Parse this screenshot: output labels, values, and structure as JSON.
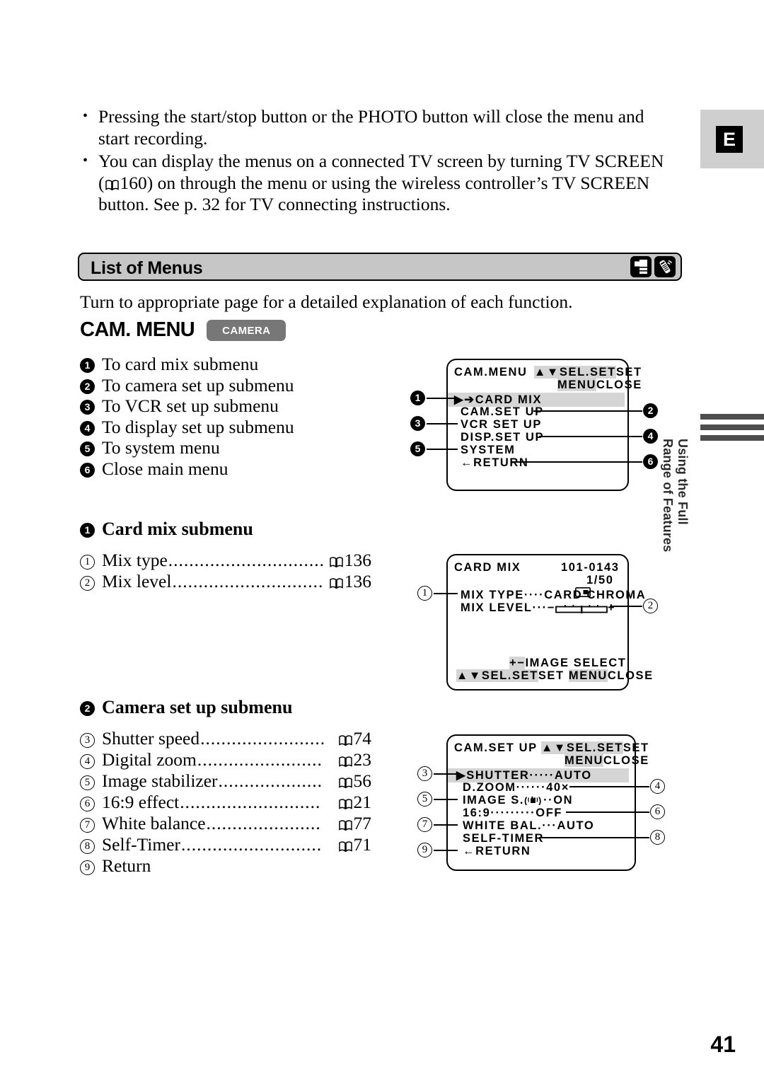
{
  "page": {
    "number": "41",
    "language_tab": "E",
    "side_note": [
      "Using the Full",
      "Range of Features"
    ]
  },
  "intro_bullets": [
    "Pressing the start/stop button or the PHOTO button will close the menu and start recording.",
    "You can display the menus on a connected TV screen by turning TV SCREEN ( 160) on through the menu or using the wireless controller’s TV SCREEN button. See p. 32 for TV connecting instructions."
  ],
  "intro_bullet_1_line1": "Pressing the start/stop button or the PHOTO button will close the menu and",
  "intro_bullet_1_line2": "start recording.",
  "intro_bullet_2_line1": "You can display the menus on a connected TV screen by turning TV SCREEN",
  "intro_bullet_2_line2_pre": "(",
  "intro_bullet_2_line2_post": "160) on through the menu or using the wireless controller’s TV SCREEN",
  "intro_bullet_2_line3": "button. See p. 32 for TV connecting instructions.",
  "section": {
    "title": "List of Menus",
    "icons": [
      "camcorder-icon",
      "wireless-controller-icon"
    ],
    "lead": "Turn to appropriate page for a detailed explanation of each function.",
    "heading": "CAM. MENU",
    "badge": "CAMERA"
  },
  "main_menu_list": [
    {
      "num": "1",
      "label": "To card mix submenu"
    },
    {
      "num": "2",
      "label": "To camera set up submenu"
    },
    {
      "num": "3",
      "label": "To VCR set up submenu"
    },
    {
      "num": "4",
      "label": "To display set up submenu"
    },
    {
      "num": "5",
      "label": "To system menu"
    },
    {
      "num": "6",
      "label": "Close main menu"
    }
  ],
  "card_mix_section": {
    "num": "1",
    "title": "Card mix submenu",
    "items": [
      {
        "num": "1",
        "label": "Mix type",
        "dots": "..............................",
        "page": "136"
      },
      {
        "num": "2",
        "label": "Mix level",
        "dots": ".............................",
        "page": "136"
      }
    ]
  },
  "camera_setup_section": {
    "num": "2",
    "title": "Camera set up submenu",
    "items": [
      {
        "num": "3",
        "label": "Shutter speed",
        "dots": "........................",
        "page": "74"
      },
      {
        "num": "4",
        "label": "Digital zoom",
        "dots": "........................",
        "page": "23"
      },
      {
        "num": "5",
        "label": "Image stabilizer",
        "dots": "....................",
        "page": "56"
      },
      {
        "num": "6",
        "label": "16:9 effect",
        "dots": "...........................",
        "page": "21"
      },
      {
        "num": "7",
        "label": "White balance",
        "dots": "......................",
        "page": "77"
      },
      {
        "num": "8",
        "label": "Self-Timer",
        "dots": "...........................",
        "page": "71"
      },
      {
        "num": "9",
        "label": "Return",
        "dots": "",
        "page": ""
      }
    ]
  },
  "lcd_cam_menu": {
    "title": "CAM.MENU",
    "hint_line1_hl1": "▲▼SEL.",
    "hint_line1_hl2": "SET",
    "hint_line1_tail": "SET",
    "hint_line2_hl": "MENU",
    "hint_line2_tail": "CLOSE",
    "rows": [
      {
        "callout": "1",
        "text": "▶➔CARD MIX",
        "selected": true,
        "side": "left"
      },
      {
        "callout": "2",
        "text": "CAM.SET UP",
        "selected": false,
        "side": "right"
      },
      {
        "callout": "3",
        "text": "VCR SET UP",
        "selected": false,
        "side": "left"
      },
      {
        "callout": "4",
        "text": "DISP.SET UP",
        "selected": false,
        "side": "right"
      },
      {
        "callout": "5",
        "text": "SYSTEM",
        "selected": false,
        "side": "left"
      },
      {
        "callout": "6",
        "text": "←RETURN",
        "selected": false,
        "side": "right"
      }
    ]
  },
  "lcd_card_mix": {
    "title": "CARD MIX",
    "file_no": "101-0143",
    "frame_count": "1/50",
    "card_icon": "memory-card-icon",
    "rows": [
      {
        "callout": "1",
        "text": "MIX TYPE····CARD CHROMA",
        "side": "left"
      },
      {
        "callout": "2",
        "text": "MIX LEVEL···",
        "side": "right",
        "has_slider": true
      }
    ],
    "slider_minus": "−",
    "slider_plus": "+",
    "footer_line1_hl": "+−",
    "footer_line1_tail": "IMAGE SELECT",
    "footer_line2_hl1": "▲▼SEL.",
    "footer_line2_hl2": "SET",
    "footer_line2_mid": "SET ",
    "footer_line2_hl3": "MENU",
    "footer_line2_tail": "CLOSE"
  },
  "lcd_cam_setup": {
    "title": "CAM.SET UP",
    "hint_line1_hl1": "▲▼SEL.",
    "hint_line1_hl2": "SET",
    "hint_line1_tail": "SET",
    "hint_line2_hl": "MENU",
    "hint_line2_tail": "CLOSE",
    "rows": [
      {
        "callout": "3",
        "text": "▶SHUTTER·····AUTO",
        "selected": true,
        "side": "left"
      },
      {
        "callout": "4",
        "text": "D.ZOOM······40×",
        "selected": false,
        "side": "right"
      },
      {
        "callout": "5",
        "text": "IMAGE S.",
        "text_after": "··ON",
        "selected": false,
        "side": "left",
        "has_stabilizer_icon": true
      },
      {
        "callout": "6",
        "text": "16:9·········OFF",
        "selected": false,
        "side": "right"
      },
      {
        "callout": "7",
        "text": "WHITE BAL.···AUTO",
        "selected": false,
        "side": "left"
      },
      {
        "callout": "8",
        "text": "SELF-TIMER",
        "selected": false,
        "side": "right"
      },
      {
        "callout": "9",
        "text": "←RETURN",
        "selected": false,
        "side": "left"
      }
    ]
  }
}
